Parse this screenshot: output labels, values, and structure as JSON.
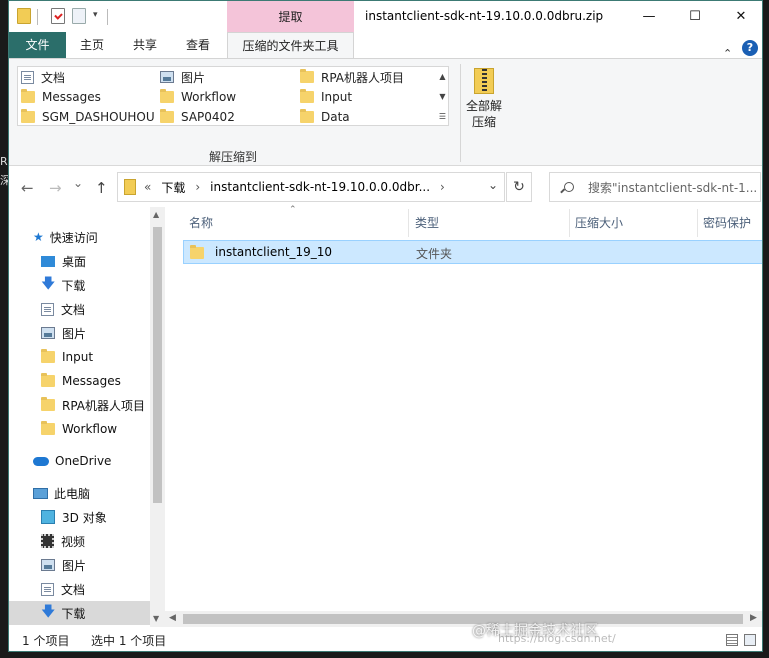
{
  "window": {
    "title": "instantclient-sdk-nt-19.10.0.0.0dbru.zip",
    "context_tab": "提取",
    "controls": {
      "minimize": "—",
      "maximize": "☐",
      "close": "✕"
    }
  },
  "ribbon": {
    "tabs": [
      "文件",
      "主页",
      "共享",
      "查看",
      "压缩的文件夹工具"
    ],
    "gallery": [
      [
        "文档",
        "图片",
        "RPA机器人项目"
      ],
      [
        "Messages",
        "Workflow",
        "Input"
      ],
      [
        "SGM_DASHOUHOU",
        "SAP0402",
        "Data"
      ]
    ],
    "group_label": "解压缩到",
    "extract_all": [
      "全部解",
      "压缩"
    ],
    "help": "?"
  },
  "address": {
    "back": "←",
    "forward": "→",
    "recent": "⌄",
    "up": "↑",
    "crumb_prefix": "«",
    "crumbs": [
      "下载",
      "instantclient-sdk-nt-19.10.0.0.0dbr..."
    ],
    "sep": "›",
    "dropdown": "⌄",
    "refresh": "↻",
    "search_placeholder": "搜索\"instantclient-sdk-nt-1..."
  },
  "nav": {
    "quick_access": "快速访问",
    "items": [
      "桌面",
      "下载",
      "文档",
      "图片",
      "Input",
      "Messages",
      "RPA机器人项目",
      "Workflow"
    ],
    "onedrive": "OneDrive",
    "this_pc": "此电脑",
    "pc_items": [
      "3D 对象",
      "视频",
      "图片",
      "文档",
      "下载"
    ]
  },
  "columns": [
    "名称",
    "类型",
    "压缩大小",
    "密码保护"
  ],
  "files": [
    {
      "name": "instantclient_19_10",
      "type": "文件夹"
    }
  ],
  "status": {
    "count": "1 个项目",
    "selected": "选中 1 个项目"
  },
  "watermark": {
    "main": "@稀土掘金技术社区",
    "url": "https://blog.csdn.net/"
  },
  "colors": {
    "accent": "#2b6e6a",
    "context": "#f4c4d9",
    "selection": "#cce8ff",
    "folder": "#f6d36b"
  }
}
